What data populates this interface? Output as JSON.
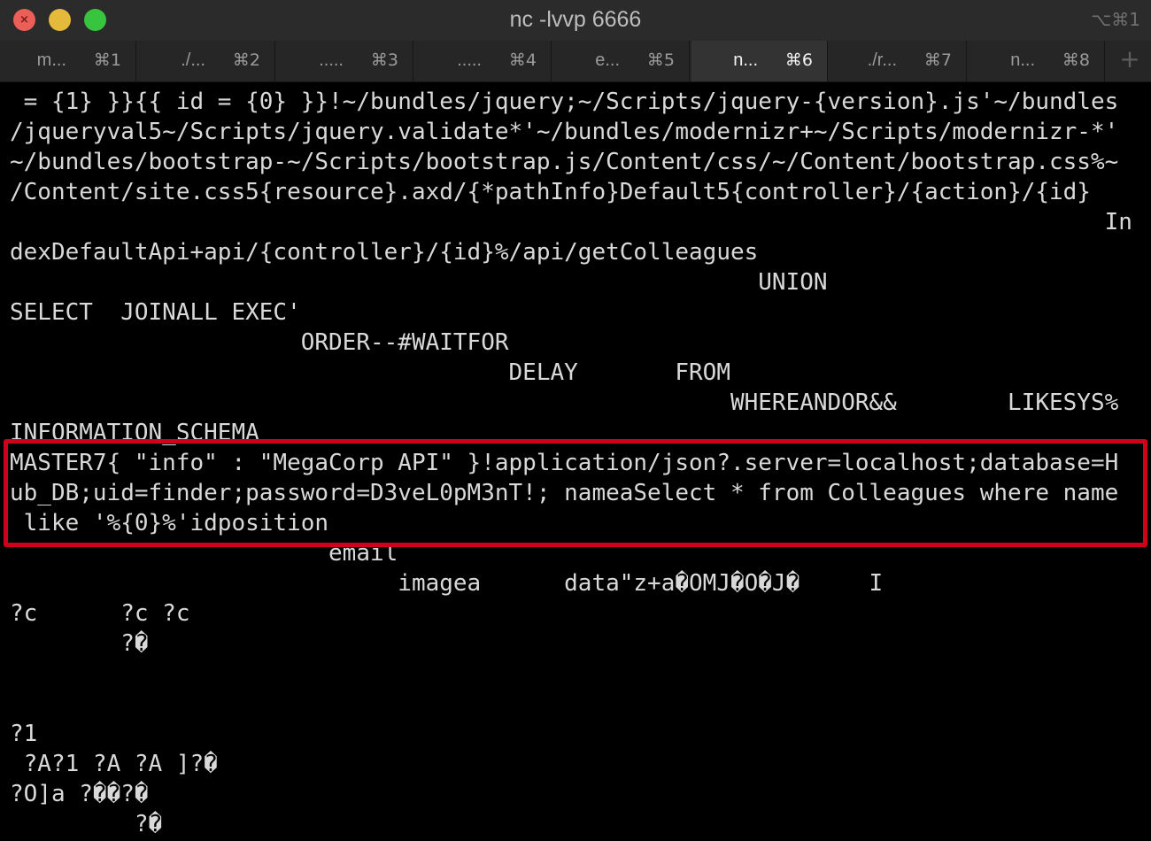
{
  "window": {
    "title": "nc -lvvp 6666",
    "shortcut": "⌥⌘1",
    "close_glyph": "×",
    "colors": {
      "background": "#000000",
      "titlebar": "#2b2b2b",
      "text": "#d9d9d9",
      "highlight": "#d0021b"
    }
  },
  "tabs": [
    {
      "label": "m...",
      "key": "⌘1",
      "active": false
    },
    {
      "label": "./...",
      "key": "⌘2",
      "active": false
    },
    {
      "label": ".....",
      "key": "⌘3",
      "active": false
    },
    {
      "label": ".....",
      "key": "⌘4",
      "active": false
    },
    {
      "label": "e...",
      "key": "⌘5",
      "active": false
    },
    {
      "label": "n...",
      "key": "⌘6",
      "active": true
    },
    {
      "label": "./r...",
      "key": "⌘7",
      "active": false
    },
    {
      "label": "n...",
      "key": "⌘8",
      "active": false
    }
  ],
  "new_tab_icon": "+",
  "terminal": {
    "lines": [
      " = {1} }}{{ id = {0} }}!~/bundles/jquery;~/Scripts/jquery-{version}.js'~/bundles",
      "/jqueryval5~/Scripts/jquery.validate*'~/bundles/modernizr+~/Scripts/modernizr-*'",
      "~/bundles/bootstrap-~/Scripts/bootstrap.js/Content/css/~/Content/bootstrap.css%~",
      "/Content/site.css5{resource}.axd/{*pathInfo}Default5{controller}/{action}/{id}",
      "                                                                               In",
      "dexDefaultApi+api/{controller}/{id}%/api/getColleagues",
      "                                                      UNION",
      "SELECT  JOINALL EXEC'",
      "                     ORDER--#WAITFOR",
      "                                    DELAY       FROM",
      "                                                    WHEREANDOR&&        LIKESYS%",
      "INFORMATION_SCHEMA",
      "MASTER7{ \"info\" : \"MegaCorp API\" }!application/json?.server=localhost;database=H",
      "ub_DB;uid=finder;password=D3veL0pM3nT!; nameaSelect * from Colleagues where name",
      " like '%{0}%'idposition",
      "                       email",
      "                            imagea      data\"z+a�OMJ�O�J�     I",
      "?c      ?c ?c",
      "        ?�",
      "",
      "",
      "?1",
      " ?A?1 ?A ?A ]?�",
      "?O]a ?��?�",
      "         ?�"
    ]
  }
}
